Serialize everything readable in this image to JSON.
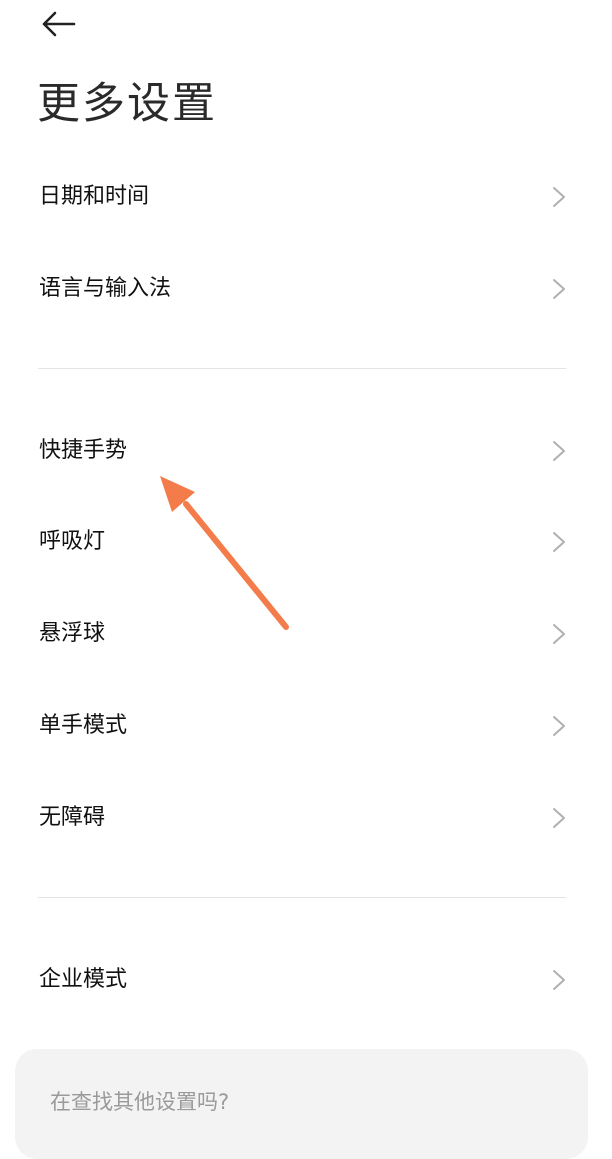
{
  "header": {
    "back_icon": "back-arrow-icon",
    "title": "更多设置"
  },
  "group1": [
    {
      "label": "日期和时间",
      "icon": "chevron-right-icon"
    },
    {
      "label": "语言与输入法",
      "icon": "chevron-right-icon"
    }
  ],
  "group2": [
    {
      "label": "快捷手势",
      "icon": "chevron-right-icon"
    },
    {
      "label": "呼吸灯",
      "icon": "chevron-right-icon"
    },
    {
      "label": "悬浮球",
      "icon": "chevron-right-icon"
    },
    {
      "label": "单手模式",
      "icon": "chevron-right-icon"
    },
    {
      "label": "无障碍",
      "icon": "chevron-right-icon"
    }
  ],
  "group3": [
    {
      "label": "企业模式",
      "icon": "chevron-right-icon"
    }
  ],
  "search": {
    "placeholder": "在查找其他设置吗?"
  },
  "annotation": {
    "icon": "pointer-arrow-icon",
    "color": "#f47c4a"
  },
  "colors": {
    "background": "#ffffff",
    "text": "#111111",
    "chevron": "#b0b0b0",
    "divider": "#e4e4e4",
    "search_bg": "#f3f3f3",
    "placeholder": "#9a9a9a"
  }
}
